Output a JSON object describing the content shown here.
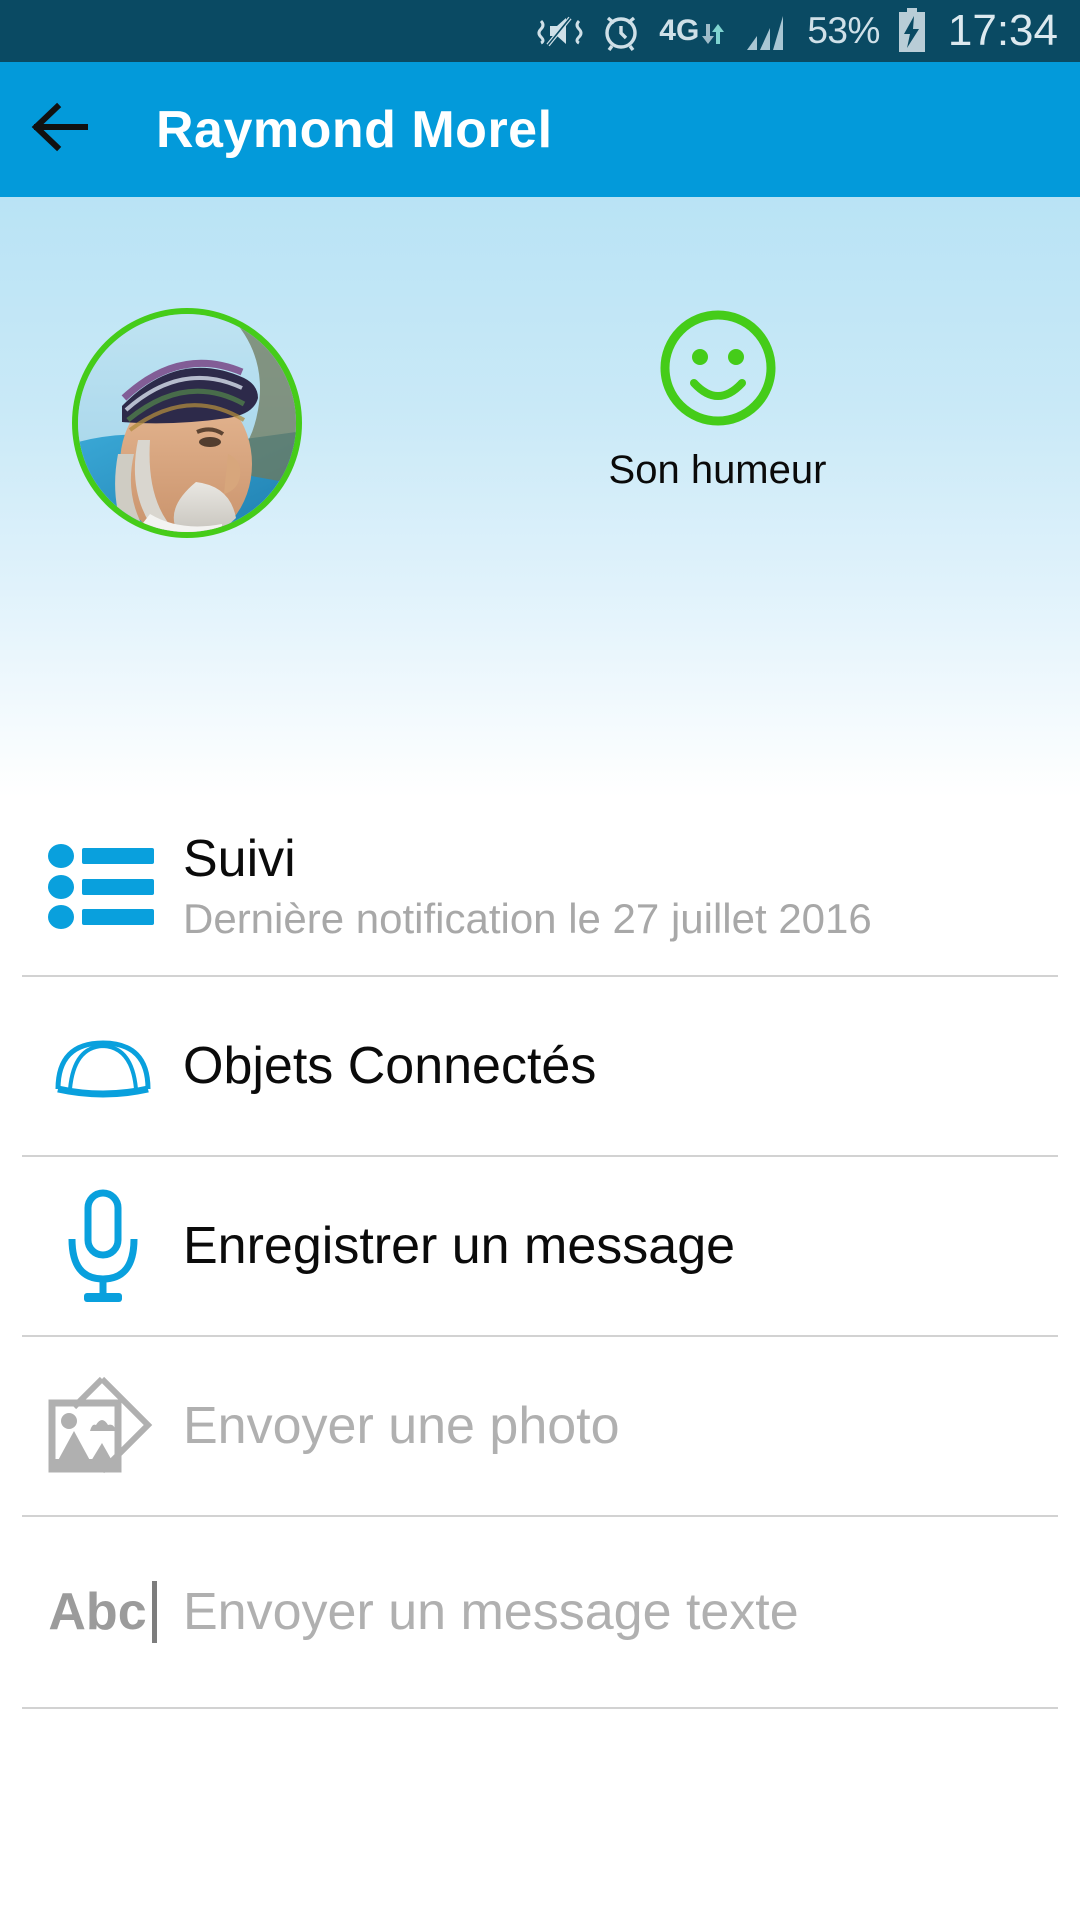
{
  "status_bar": {
    "vibrate_icon": "vibrate-mute-icon",
    "alarm_icon": "alarm-clock-icon",
    "network_label": "4G",
    "data_transfer_icon": "data-transfer-arrows-icon",
    "signal_icon": "signal-bars-icon",
    "battery_percent": "53%",
    "battery_icon": "battery-charging-icon",
    "clock": "17:34",
    "background_color": "#0a4a63",
    "text_color": "#cfe0e8"
  },
  "app_bar": {
    "back_icon": "back-arrow-icon",
    "title": "Raymond Morel",
    "background_color": "#039ada",
    "title_color": "#ffffff"
  },
  "hero": {
    "avatar": {
      "name": "profile-photo",
      "border_color": "#45cc19",
      "alt": "Raymond Morel"
    },
    "mood": {
      "icon": "smiley-face-icon",
      "label": "Son humeur",
      "color": "#45cc19"
    },
    "gradient_top": "#b9e3f5",
    "gradient_bottom": "#ffffff"
  },
  "list": {
    "items": [
      {
        "icon": "bulleted-list-icon",
        "title": "Suivi",
        "subtitle": "Dernière notification le 27 juillet 2016",
        "enabled": true,
        "icon_color": "#039ada"
      },
      {
        "icon": "connected-objects-dome-icon",
        "title": "Objets Connectés",
        "subtitle": "",
        "enabled": true,
        "icon_color": "#039ada"
      },
      {
        "icon": "microphone-icon",
        "title": "Enregistrer un message",
        "subtitle": "",
        "enabled": true,
        "icon_color": "#039ada"
      },
      {
        "icon": "photo-image-icon",
        "title": "Envoyer une photo",
        "subtitle": "",
        "enabled": false,
        "icon_color": "#b0b0b0"
      },
      {
        "icon": "abc-text-icon",
        "title": "Envoyer un message texte",
        "subtitle": "",
        "enabled": false,
        "icon_color": "#9b9b9b",
        "icon_text": "Abc"
      }
    ],
    "divider_color": "#d2d2d2"
  },
  "theme": {
    "accent_blue": "#039ada",
    "status_bar_blue": "#0a4a63",
    "accent_green": "#45cc19",
    "disabled_gray": "#b0b0b0"
  }
}
